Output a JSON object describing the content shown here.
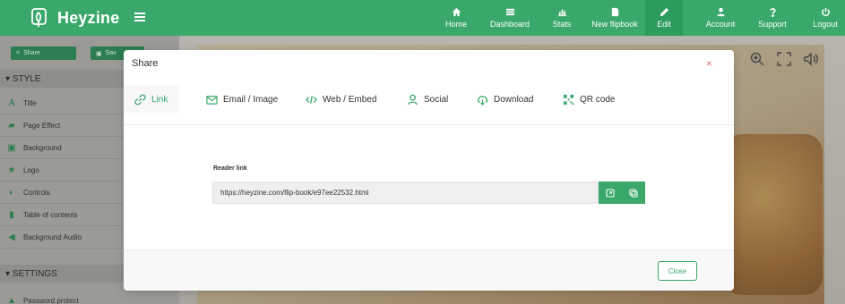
{
  "brand": {
    "name": "Heyzine"
  },
  "nav": [
    {
      "label": "Home",
      "icon": "home-icon"
    },
    {
      "label": "Dashboard",
      "icon": "list-icon"
    },
    {
      "label": "Stats",
      "icon": "bar-chart-icon"
    },
    {
      "label": "New flipbook",
      "icon": "file-icon"
    },
    {
      "label": "Edit",
      "icon": "pencil-icon",
      "active": true
    },
    {
      "label": "Account",
      "icon": "user-icon"
    },
    {
      "label": "Support",
      "icon": "question-icon"
    },
    {
      "label": "Logout",
      "icon": "power-icon"
    }
  ],
  "sidebar": {
    "share_label": "Share",
    "save_label": "Sav",
    "style_heading": "STYLE",
    "items": [
      {
        "label": "Title",
        "icon": "text-a-icon"
      },
      {
        "label": "Page Effect",
        "icon": "book-icon"
      },
      {
        "label": "Background",
        "icon": "image-icon"
      },
      {
        "label": "Logo",
        "icon": "star-icon"
      },
      {
        "label": "Controls",
        "icon": "toggle-icon"
      },
      {
        "label": "Table of contents",
        "icon": "bookmark-icon"
      },
      {
        "label": "Background Audio",
        "icon": "speaker-icon"
      }
    ],
    "settings_heading": "SETTINGS",
    "settings_items": [
      {
        "label": "Password protect",
        "icon": "lock-icon"
      }
    ]
  },
  "modal": {
    "title": "Share",
    "close_symbol": "×",
    "tabs": [
      {
        "label": "Link",
        "icon": "link-icon",
        "active": true
      },
      {
        "label": "Email / Image",
        "icon": "email-icon"
      },
      {
        "label": "Web / Embed",
        "icon": "code-icon"
      },
      {
        "label": "Social",
        "icon": "person-icon"
      },
      {
        "label": "Download",
        "icon": "cloud-download-icon"
      },
      {
        "label": "QR code",
        "icon": "qr-icon"
      }
    ],
    "reader_link_label": "Reader link",
    "reader_link_value": "https://heyzine.com/flip-book/e97ee22532.html",
    "close_button_label": "Close"
  },
  "colors": {
    "brand_green": "#3aa86a",
    "close_red": "#e06b6b"
  }
}
